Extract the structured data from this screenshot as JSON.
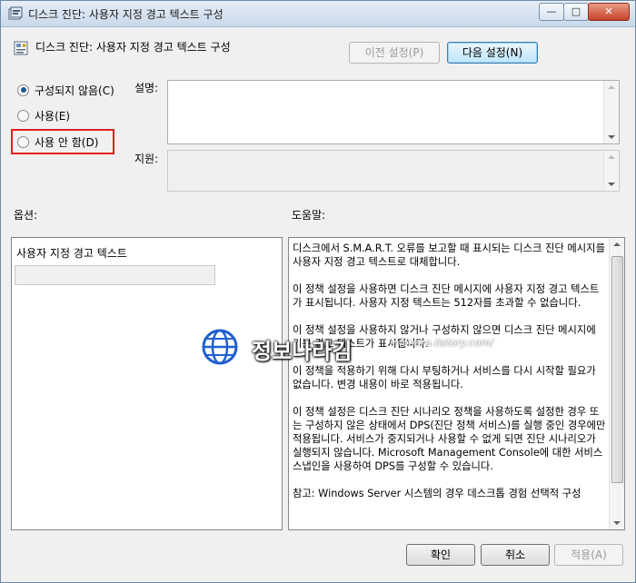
{
  "window": {
    "title": "디스크 진단: 사용자 지정 경고 텍스트 구성",
    "controls": {
      "minimize": "—",
      "maximize": "□",
      "close": "✕"
    }
  },
  "header": {
    "policy_title": "디스크 진단: 사용자 지정 경고 텍스트 구성",
    "prev_button": "이전 설정(P)",
    "next_button": "다음 설정(N)"
  },
  "state_options": {
    "items": [
      {
        "label": "구성되지 않음(C)",
        "checked": true
      },
      {
        "label": "사용(E)",
        "checked": false
      },
      {
        "label": "사용 안 함(D)",
        "checked": false
      }
    ],
    "highlight_color": "#e02020"
  },
  "fields": {
    "comment_label": "설명:",
    "comment_value": "",
    "supported_label": "지원:",
    "supported_value": ""
  },
  "options": {
    "section_label": "옵션:",
    "custom_text_label": "사용자 지정 경고 텍스트",
    "custom_text_value": ""
  },
  "help": {
    "section_label": "도움말:",
    "paragraphs": [
      "디스크에서 S.M.A.R.T. 오류를 보고할 때 표시되는 디스크 진단 메시지를 사용자 지정 경고 텍스트로 대체합니다.",
      "이 정책 설정을 사용하면 디스크 진단 메시지에 사용자 지정 경고 텍스트가 표시됩니다.  사용자 지정 텍스트는 512자를 초과할 수 없습니다.",
      "이 정책 설정을 사용하지 않거나 구성하지 않으면 디스크 진단 메시지에 기본 경고 텍스트가 표시됩니다.",
      "이 정책을 적용하기 위해 다시 부팅하거나 서비스를 다시 시작할 필요가 없습니다. 변경 내용이 바로 적용됩니다.",
      "이 정책 설정은 디스크 진단 시나리오 정책을 사용하도록 설정한 경우 또는 구성하지 않은 상태에서 DPS(진단 정책 서비스)를 실행 중인 경우에만 적용됩니다. 서비스가 중지되거나 사용할 수 없게 되면 진단 시나리오가 실행되지 않습니다.  Microsoft Management Console에 대한 서비스 스냅인을 사용하여 DPS를 구성할 수 있습니다.",
      "참고: Windows Server 시스템의 경우 데스크톱 경험 선택적 구성"
    ]
  },
  "watermark": {
    "title": "정보나라김",
    "url": "infonara.tistory.com/"
  },
  "footer": {
    "ok_button": "확인",
    "cancel_button": "취소",
    "apply_button": "적용(A)"
  }
}
